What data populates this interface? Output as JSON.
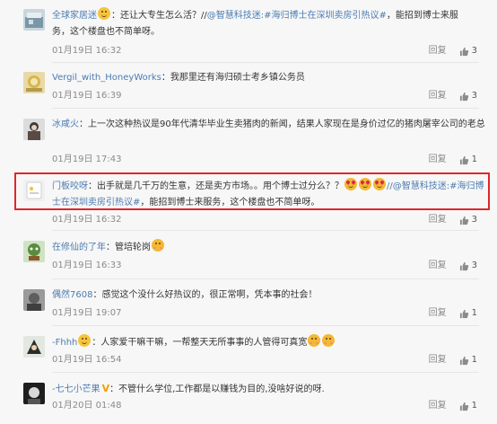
{
  "comments": [
    {
      "user": "全球家居迷",
      "user_emoji": "face",
      "colon": "：",
      "text_before": "还让大专生怎么活？//",
      "topic": "@智慧科技迷:#海归博士在深圳卖房引热议#",
      "text_after": "，能招到博士来服务，这个楼盘也不简单呀。",
      "time": "01月19日 16:32",
      "reply": "回复",
      "likes": "3"
    },
    {
      "user": "Vergil_with_HoneyWorks",
      "colon": "：",
      "text": "我那里还有海归硕士考乡镇公务员",
      "time": "01月19日 16:39",
      "reply": "回复",
      "likes": "3"
    },
    {
      "user": "冰咸火",
      "colon": "：",
      "text": "上一次这种热议是90年代清华毕业生卖猪肉的新闻，结果人家现在是身价过亿的猪肉屠宰公司的老总",
      "time": "01月19日 17:43",
      "reply": "回复",
      "likes": "1"
    },
    {
      "user": "门板咬呀",
      "colon": "：",
      "text_before": "出手就是几千万的生意，还是卖方市场。。用个博士过分么？？",
      "topic": "//@智慧科技迷:#海归博士在深圳卖房引热议#",
      "text_after": "，能招到博士来服务，这个楼盘也不简单呀。",
      "time": "01月19日 16:32",
      "reply": "回复",
      "likes": "3"
    },
    {
      "user": "在修仙的了年",
      "colon": "：",
      "text": "管培轮岗",
      "time": "01月19日 16:33",
      "reply": "回复",
      "likes": "3"
    },
    {
      "user": "偶然7608",
      "colon": "：",
      "text": "感觉这个没什么好热议的，很正常啊，凭本事的社会！",
      "time": "01月19日 19:07",
      "reply": "回复",
      "likes": "1"
    },
    {
      "user": "-Fhhh",
      "colon": "：",
      "text": "人家爱干嘛干嘛，一帮整天无所事事的人管得可真宽",
      "time": "01月19日 16:54",
      "reply": "回复",
      "likes": "1"
    },
    {
      "user": "-七七小芒果",
      "badge": "V",
      "colon": "：",
      "text": "不管什么学位,工作都是以赚钱为目的,没啥好说的呀.",
      "time": "01月20日 01:48",
      "reply": "回复",
      "likes": "1"
    }
  ]
}
